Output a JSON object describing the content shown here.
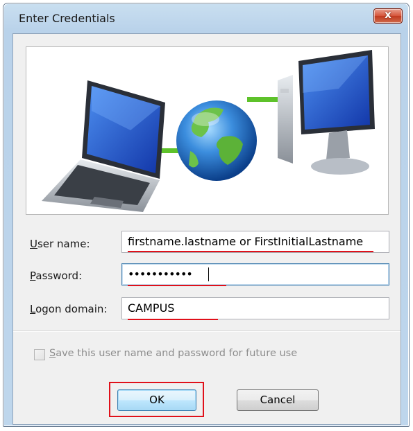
{
  "window": {
    "title": "Enter Credentials",
    "close_label": "x"
  },
  "banner": {
    "icons": [
      "laptop-icon",
      "globe-icon",
      "desktop-computer-icon"
    ]
  },
  "form": {
    "username": {
      "label_access_key": "U",
      "label_rest": "ser name:",
      "value": "firstname.lastname or FirstInitialLastname"
    },
    "password": {
      "label_access_key": "P",
      "label_rest": "assword:",
      "value": "•••••••••••"
    },
    "domain": {
      "label_access_key": "L",
      "label_rest": "ogon domain:",
      "value": "CAMPUS"
    },
    "save": {
      "label_access_key": "S",
      "label_rest": "ave this user name and password for future use",
      "checked": false,
      "enabled": false
    }
  },
  "buttons": {
    "ok_label": "OK",
    "cancel_label": "Cancel"
  },
  "colors": {
    "annotation_red": "#e0101a",
    "focus_border": "#3d7bad",
    "close_button": "#c13a20"
  }
}
